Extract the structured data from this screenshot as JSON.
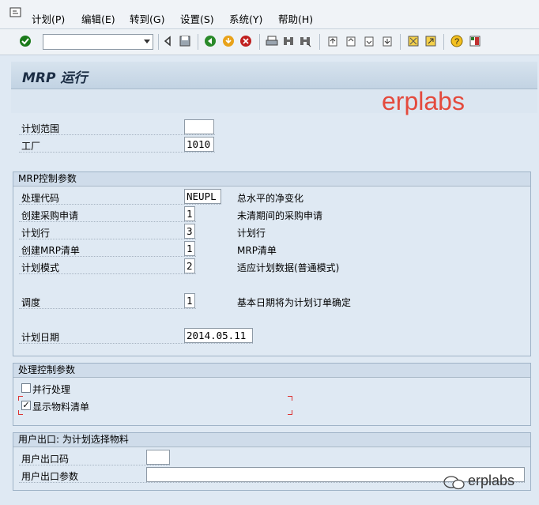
{
  "menu": [
    "计划(P)",
    "编辑(E)",
    "转到(G)",
    "设置(S)",
    "系统(Y)",
    "帮助(H)"
  ],
  "command_field": {
    "value": ""
  },
  "title": "MRP 运行",
  "watermark": "erplabs",
  "top_fields": {
    "plan_scope_label": "计划范围",
    "plan_scope_value": "",
    "plant_label": "工厂",
    "plant_value": "1010"
  },
  "mrp_group": {
    "title": "MRP控制参数",
    "rows": [
      {
        "label": "处理代码",
        "value": "NEUPL",
        "desc": "总水平的净变化"
      },
      {
        "label": "创建采购申请",
        "value": "1",
        "desc": "未清期间的采购申请"
      },
      {
        "label": "计划行",
        "value": "3",
        "desc": "计划行"
      },
      {
        "label": "创建MRP清单",
        "value": "1",
        "desc": "MRP清单"
      },
      {
        "label": "计划模式",
        "value": "2",
        "desc": "适应计划数据(普通模式)"
      },
      {
        "label": "调度",
        "value": "1",
        "desc": "基本日期将为计划订单确定"
      },
      {
        "label": "计划日期",
        "value": "2014.05.11",
        "desc": ""
      }
    ]
  },
  "proc_group": {
    "title": "处理控制参数",
    "parallel_label": "并行处理",
    "parallel_checked": false,
    "display_label": "显示物料清单",
    "display_checked": true
  },
  "user_group": {
    "title": "用户出口: 为计划选择物料",
    "exit_code_label": "用户出口码",
    "exit_code_value": "",
    "exit_param_label": "用户出口参数",
    "exit_param_value": ""
  },
  "footer_watermark": "erplabs"
}
